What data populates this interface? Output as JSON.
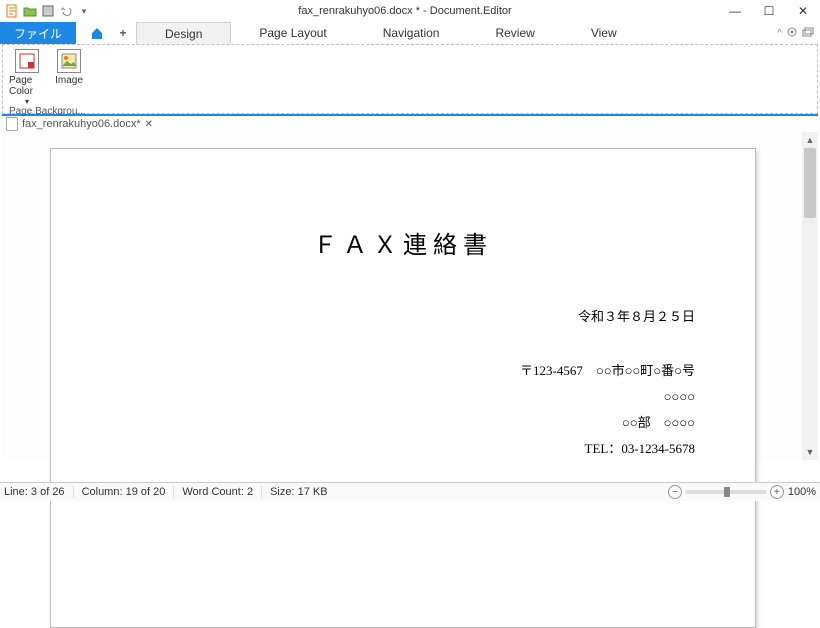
{
  "title": "fax_renrakuhyo06.docx * - Document.Editor",
  "menu": {
    "file": "ファイル",
    "items": [
      "Design",
      "Page Layout",
      "Navigation",
      "Review",
      "View"
    ]
  },
  "ribbon": {
    "page_color": "Page Color",
    "dropdown_glyph": "▾",
    "image": "Image",
    "group_label": "Page Backgrou..."
  },
  "doctab": {
    "name": "fax_renrakuhyo06.docx*",
    "close": "✕"
  },
  "document": {
    "title": "ＦＡＸ連絡書",
    "date": "令和３年８月２５日",
    "addr1": "〒123-4567　○○市○○町○番○号",
    "addr2": "○○○○",
    "addr3": "○○部　○○○○",
    "tel": "TEL：03-1234-5678"
  },
  "status": {
    "line": "Line: 3 of 26",
    "column": "Column: 19 of 20",
    "wordcount": "Word Count: 2",
    "size": "Size: 17 KB",
    "zoom": "100%"
  },
  "win": {
    "min": "—",
    "max": "☐",
    "close": "✕"
  },
  "qa": {
    "dropdown": "▾"
  },
  "menu_right": {
    "caret": "^"
  }
}
